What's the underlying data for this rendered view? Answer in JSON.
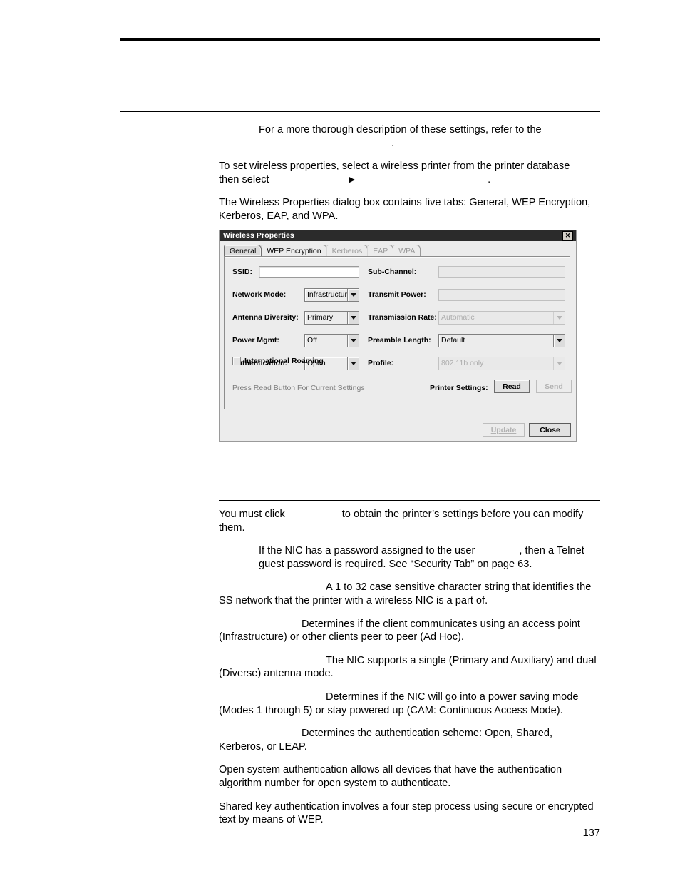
{
  "page": {
    "number": "137"
  },
  "content": {
    "note": {
      "line1": "For a more thorough description of these settings, refer to the",
      "line2_end": "."
    },
    "para_set_props": {
      "line1": "To set wireless properties, select a wireless printer from the printer database",
      "line2_prefix": "then select",
      "menu_separator": "▶",
      "line2_end": "."
    },
    "para_tabs": "The Wireless Properties dialog box contains five tabs: General, WEP Encryption, Kerberos, EAP, and WPA.",
    "para_must_click": {
      "prefix": "You must click",
      "suffix": "to obtain the printer’s settings before you can modify them."
    },
    "para_nic_password": {
      "prefix": "If the NIC has a password assigned to the user",
      "suffix": ", then a Telnet guest password is required. See “Security Tab” on page 63."
    },
    "para_ssid": "A 1 to 32 case sensitive character string that identifies the SS network that the printer with a wireless NIC is a part of.",
    "para_network_mode": "Determines if the client communicates using an access point (Infrastructure) or other clients peer to peer (Ad Hoc).",
    "para_antenna": "The NIC supports a single (Primary and Auxiliary) and dual (Diverse) antenna mode.",
    "para_power_mgmt": "Determines if the NIC will go into a power saving mode (Modes 1 through 5) or stay powered up (CAM: Continuous Access Mode).",
    "para_authentication": "Determines the authentication scheme: Open, Shared, Kerberos, or LEAP.",
    "para_open_system": "Open system authentication allows all devices that have the authentication algorithm number for open system to authenticate.",
    "para_shared_key": "Shared key authentication involves a four step process using secure or encrypted text by means of WEP."
  },
  "dialog": {
    "title": "Wireless Properties",
    "close_label": "✕",
    "tabs": [
      {
        "label": "General",
        "state": "selected"
      },
      {
        "label": "WEP Encryption",
        "state": "enabled"
      },
      {
        "label": "Kerberos",
        "state": "disabled"
      },
      {
        "label": "EAP",
        "state": "disabled"
      },
      {
        "label": "WPA",
        "state": "disabled"
      }
    ],
    "fields": {
      "ssid": {
        "label": "SSID:",
        "value": "",
        "type": "text",
        "enabled": true
      },
      "sub_channel": {
        "label": "Sub-Channel:",
        "value": "",
        "type": "text",
        "enabled": false
      },
      "network_mode": {
        "label": "Network Mode:",
        "value": "Infrastructure",
        "type": "combo",
        "enabled": true
      },
      "transmit_power": {
        "label": "Transmit Power:",
        "value": "",
        "type": "text",
        "enabled": false
      },
      "antenna_diversity": {
        "label": "Antenna Diversity:",
        "value": "Primary",
        "type": "combo",
        "enabled": true
      },
      "transmission_rate": {
        "label": "Transmission Rate:",
        "value": "Automatic",
        "type": "combo",
        "enabled": false
      },
      "power_mgmt": {
        "label": "Power Mgmt:",
        "value": "Off",
        "type": "combo",
        "enabled": true
      },
      "preamble_length": {
        "label": "Preamble Length:",
        "value": "Default",
        "type": "combo",
        "enabled": true
      },
      "authentication": {
        "label": "Authentication:",
        "value": "Open",
        "type": "combo",
        "enabled": true
      },
      "profile": {
        "label": "Profile:",
        "value": "802.11b only",
        "type": "combo",
        "enabled": false
      }
    },
    "checkbox": {
      "label": "International Roaming",
      "checked": false
    },
    "hint": "Press Read Button For Current Settings",
    "printer_settings_label": "Printer Settings:",
    "buttons": {
      "read": {
        "label": "Read",
        "enabled": true
      },
      "send": {
        "label": "Send",
        "enabled": false
      },
      "update": {
        "label": "Update",
        "enabled": false
      },
      "close": {
        "label": "Close",
        "enabled": true
      }
    }
  },
  "colors": {
    "titlebar_bg": "#2b2b2b",
    "dialog_bg": "#ececec",
    "disabled_text": "#adadad",
    "hint_text": "#7d7d7d"
  }
}
